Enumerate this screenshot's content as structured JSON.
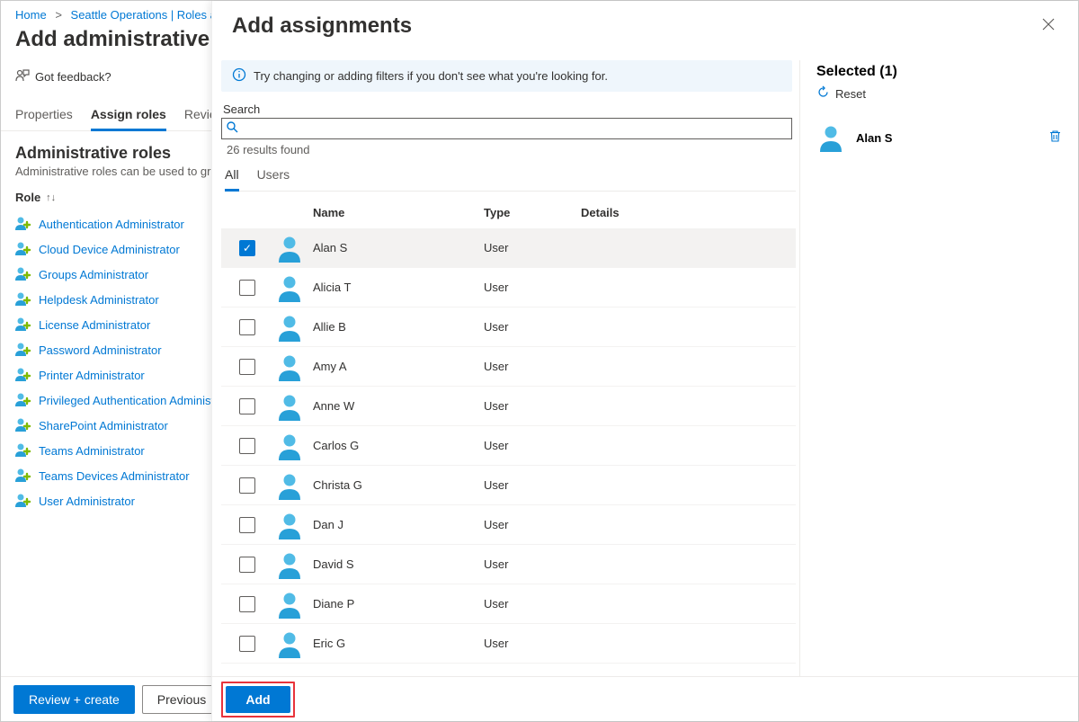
{
  "breadcrumb": {
    "home": "Home",
    "ops": "Seattle Operations | Roles and",
    "sep": ">"
  },
  "page_title": "Add administrative uni",
  "feedback": "Got feedback?",
  "tabs": {
    "properties": "Properties",
    "assign": "Assign roles",
    "review": "Review"
  },
  "section": {
    "title": "Administrative roles",
    "sub": "Administrative roles can be used to grant"
  },
  "role_col": "Role",
  "roles": [
    "Authentication Administrator",
    "Cloud Device Administrator",
    "Groups Administrator",
    "Helpdesk Administrator",
    "License Administrator",
    "Password Administrator",
    "Printer Administrator",
    "Privileged Authentication Administ",
    "SharePoint Administrator",
    "Teams Administrator",
    "Teams Devices Administrator",
    "User Administrator"
  ],
  "footer": {
    "review_create": "Review + create",
    "previous": "Previous"
  },
  "panel": {
    "title": "Add assignments",
    "info": "Try changing or adding filters if you don't see what you're looking for.",
    "search_label": "Search",
    "results": "26 results found",
    "tabs": {
      "all": "All",
      "users": "Users"
    },
    "cols": {
      "name": "Name",
      "type": "Type",
      "details": "Details"
    },
    "rows": [
      {
        "name": "Alan S",
        "type": "User",
        "selected": true
      },
      {
        "name": "Alicia T",
        "type": "User",
        "selected": false
      },
      {
        "name": "Allie B",
        "type": "User",
        "selected": false
      },
      {
        "name": "Amy A",
        "type": "User",
        "selected": false
      },
      {
        "name": "Anne W",
        "type": "User",
        "selected": false
      },
      {
        "name": "Carlos G",
        "type": "User",
        "selected": false
      },
      {
        "name": "Christa G",
        "type": "User",
        "selected": false
      },
      {
        "name": "Dan J",
        "type": "User",
        "selected": false
      },
      {
        "name": "David S",
        "type": "User",
        "selected": false
      },
      {
        "name": "Diane P",
        "type": "User",
        "selected": false
      },
      {
        "name": "Eric G",
        "type": "User",
        "selected": false
      }
    ],
    "selected_title": "Selected (1)",
    "reset": "Reset",
    "selected": [
      {
        "name": "Alan S"
      }
    ],
    "add": "Add"
  }
}
